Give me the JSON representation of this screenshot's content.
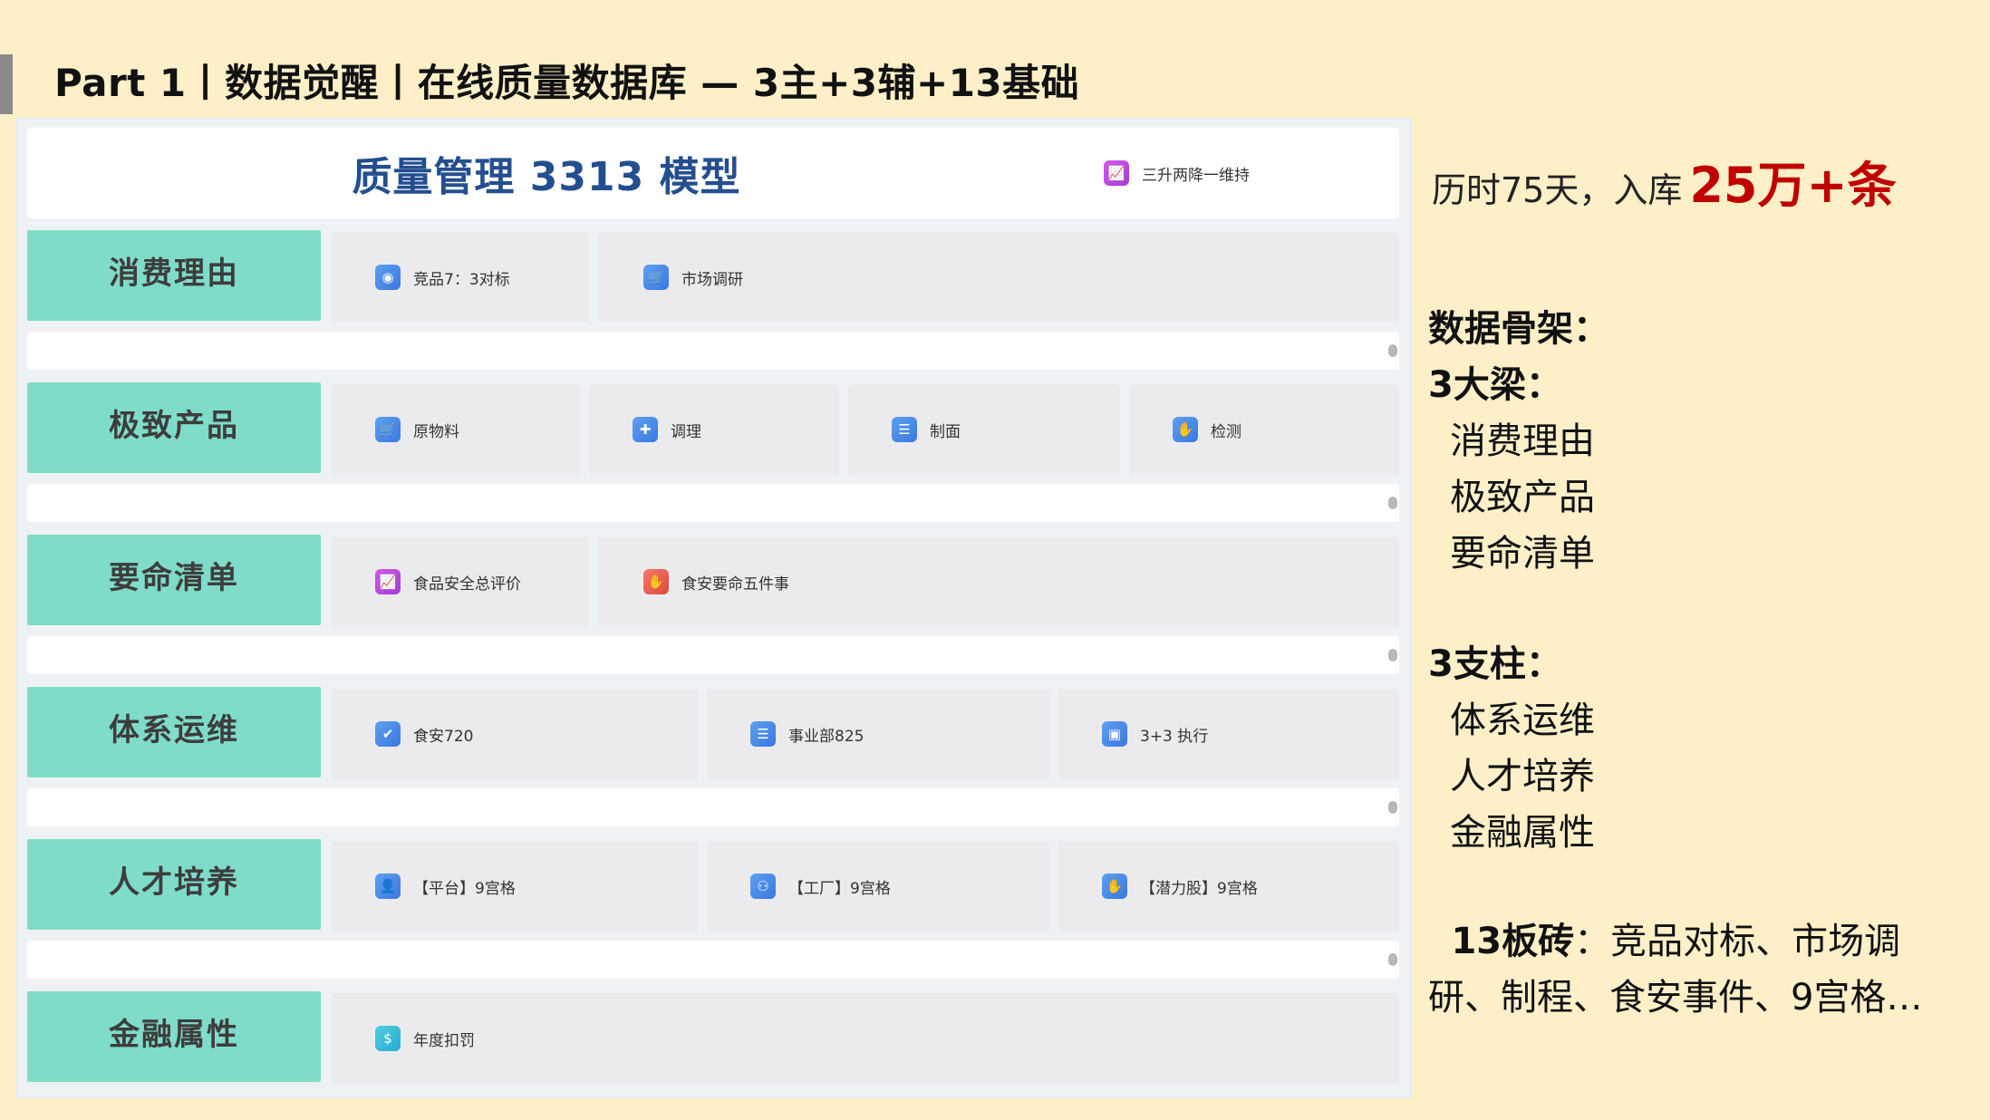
{
  "page": {
    "title": "Part 1丨数据觉醒丨在线质量数据库 — 3主+3辅+13基础"
  },
  "model": {
    "title": "质量管理 3313 模型",
    "tag": {
      "icon": "monitor-chart-icon",
      "label": "三升两降一维持"
    }
  },
  "rows": [
    {
      "label": "消费理由",
      "items": [
        {
          "icon": "globe-icon",
          "label": "竞品7：3对标"
        },
        {
          "icon": "cart-icon",
          "label": "市场调研"
        }
      ]
    },
    {
      "label": "极致产品",
      "items": [
        {
          "icon": "cart-icon",
          "label": "原物料"
        },
        {
          "icon": "puzzle-icon",
          "label": "调理"
        },
        {
          "icon": "document-icon",
          "label": "制面"
        },
        {
          "icon": "hand-icon",
          "label": "检测"
        }
      ]
    },
    {
      "label": "要命清单",
      "items": [
        {
          "icon": "monitor-chart-icon",
          "label": "食品安全总评价"
        },
        {
          "icon": "hand-icon",
          "label": "食安要命五件事"
        }
      ]
    },
    {
      "label": "体系运维",
      "items": [
        {
          "icon": "bookmark-icon",
          "label": "食安720"
        },
        {
          "icon": "document-icon",
          "label": "事业部825"
        },
        {
          "icon": "box-icon",
          "label": "3+3 执行"
        }
      ]
    },
    {
      "label": "人才培养",
      "items": [
        {
          "icon": "person-icon",
          "label": "【平台】9宫格"
        },
        {
          "icon": "org-chart-icon",
          "label": "【工厂】9宫格"
        },
        {
          "icon": "hand-icon",
          "label": "【潜力股】9宫格"
        }
      ]
    },
    {
      "label": "金融属性",
      "items": [
        {
          "icon": "money-bag-icon",
          "label": "年度扣罚"
        }
      ]
    }
  ],
  "side": {
    "summary_prefix": "历时75天，入库",
    "summary_big": "25万+条",
    "skeleton_title": "数据骨架：",
    "beams_title": "3大梁：",
    "beams": [
      "消费理由",
      "极致产品",
      "要命清单"
    ],
    "pillars_title": "3支柱：",
    "pillars": [
      "体系运维",
      "人才培养",
      "金融属性"
    ],
    "bricks_title": "13板砖",
    "bricks_text": "：竞品对标、市场调研、制程、食安事件、9宫格…"
  },
  "colors": {
    "background": "#fdf0c8",
    "row_label": "#7fdcc9",
    "model_title": "#244f8f",
    "highlight_red": "#c00000"
  }
}
